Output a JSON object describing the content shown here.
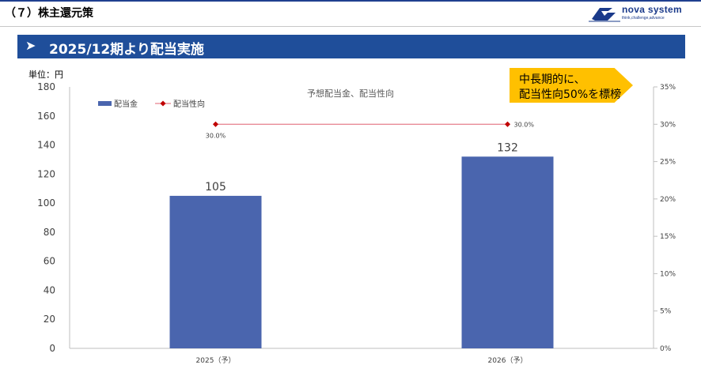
{
  "header": {
    "section_title": "（７）株主還元策",
    "logo_name": "nova system",
    "logo_tagline": "think,challenge,advance"
  },
  "banner": {
    "arrow": "➤",
    "title": "2025/12期より配当実施"
  },
  "unit_label": "単位：円",
  "callout": {
    "line1": "中長期的に、",
    "line2": "配当性向50%を標榜"
  },
  "colors": {
    "bar": "#4a65ae",
    "line": "#e06070",
    "marker": "#c00000",
    "banner": "#1f4e9a",
    "callout": "#ffc000"
  },
  "chart_data": {
    "type": "bar",
    "title": "予想配当金、配当性向",
    "categories": [
      "2025（予）",
      "2026（予）"
    ],
    "series": [
      {
        "name": "配当金",
        "type": "bar",
        "axis": "left",
        "values": [
          105,
          132
        ],
        "labels": [
          "105",
          "132"
        ]
      },
      {
        "name": "配当性向",
        "type": "line",
        "axis": "right",
        "values": [
          30.0,
          30.0
        ],
        "labels": [
          "30.0%",
          "30.0%"
        ]
      }
    ],
    "ylim": [
      0,
      180
    ],
    "yticks": [
      "0",
      "20",
      "40",
      "60",
      "80",
      "100",
      "120",
      "140",
      "160",
      "180"
    ],
    "y2lim": [
      0,
      35
    ],
    "y2ticks": [
      "0%",
      "5%",
      "10%",
      "15%",
      "20%",
      "25%",
      "30%",
      "35%"
    ],
    "legend": "top-left",
    "grid": false
  }
}
